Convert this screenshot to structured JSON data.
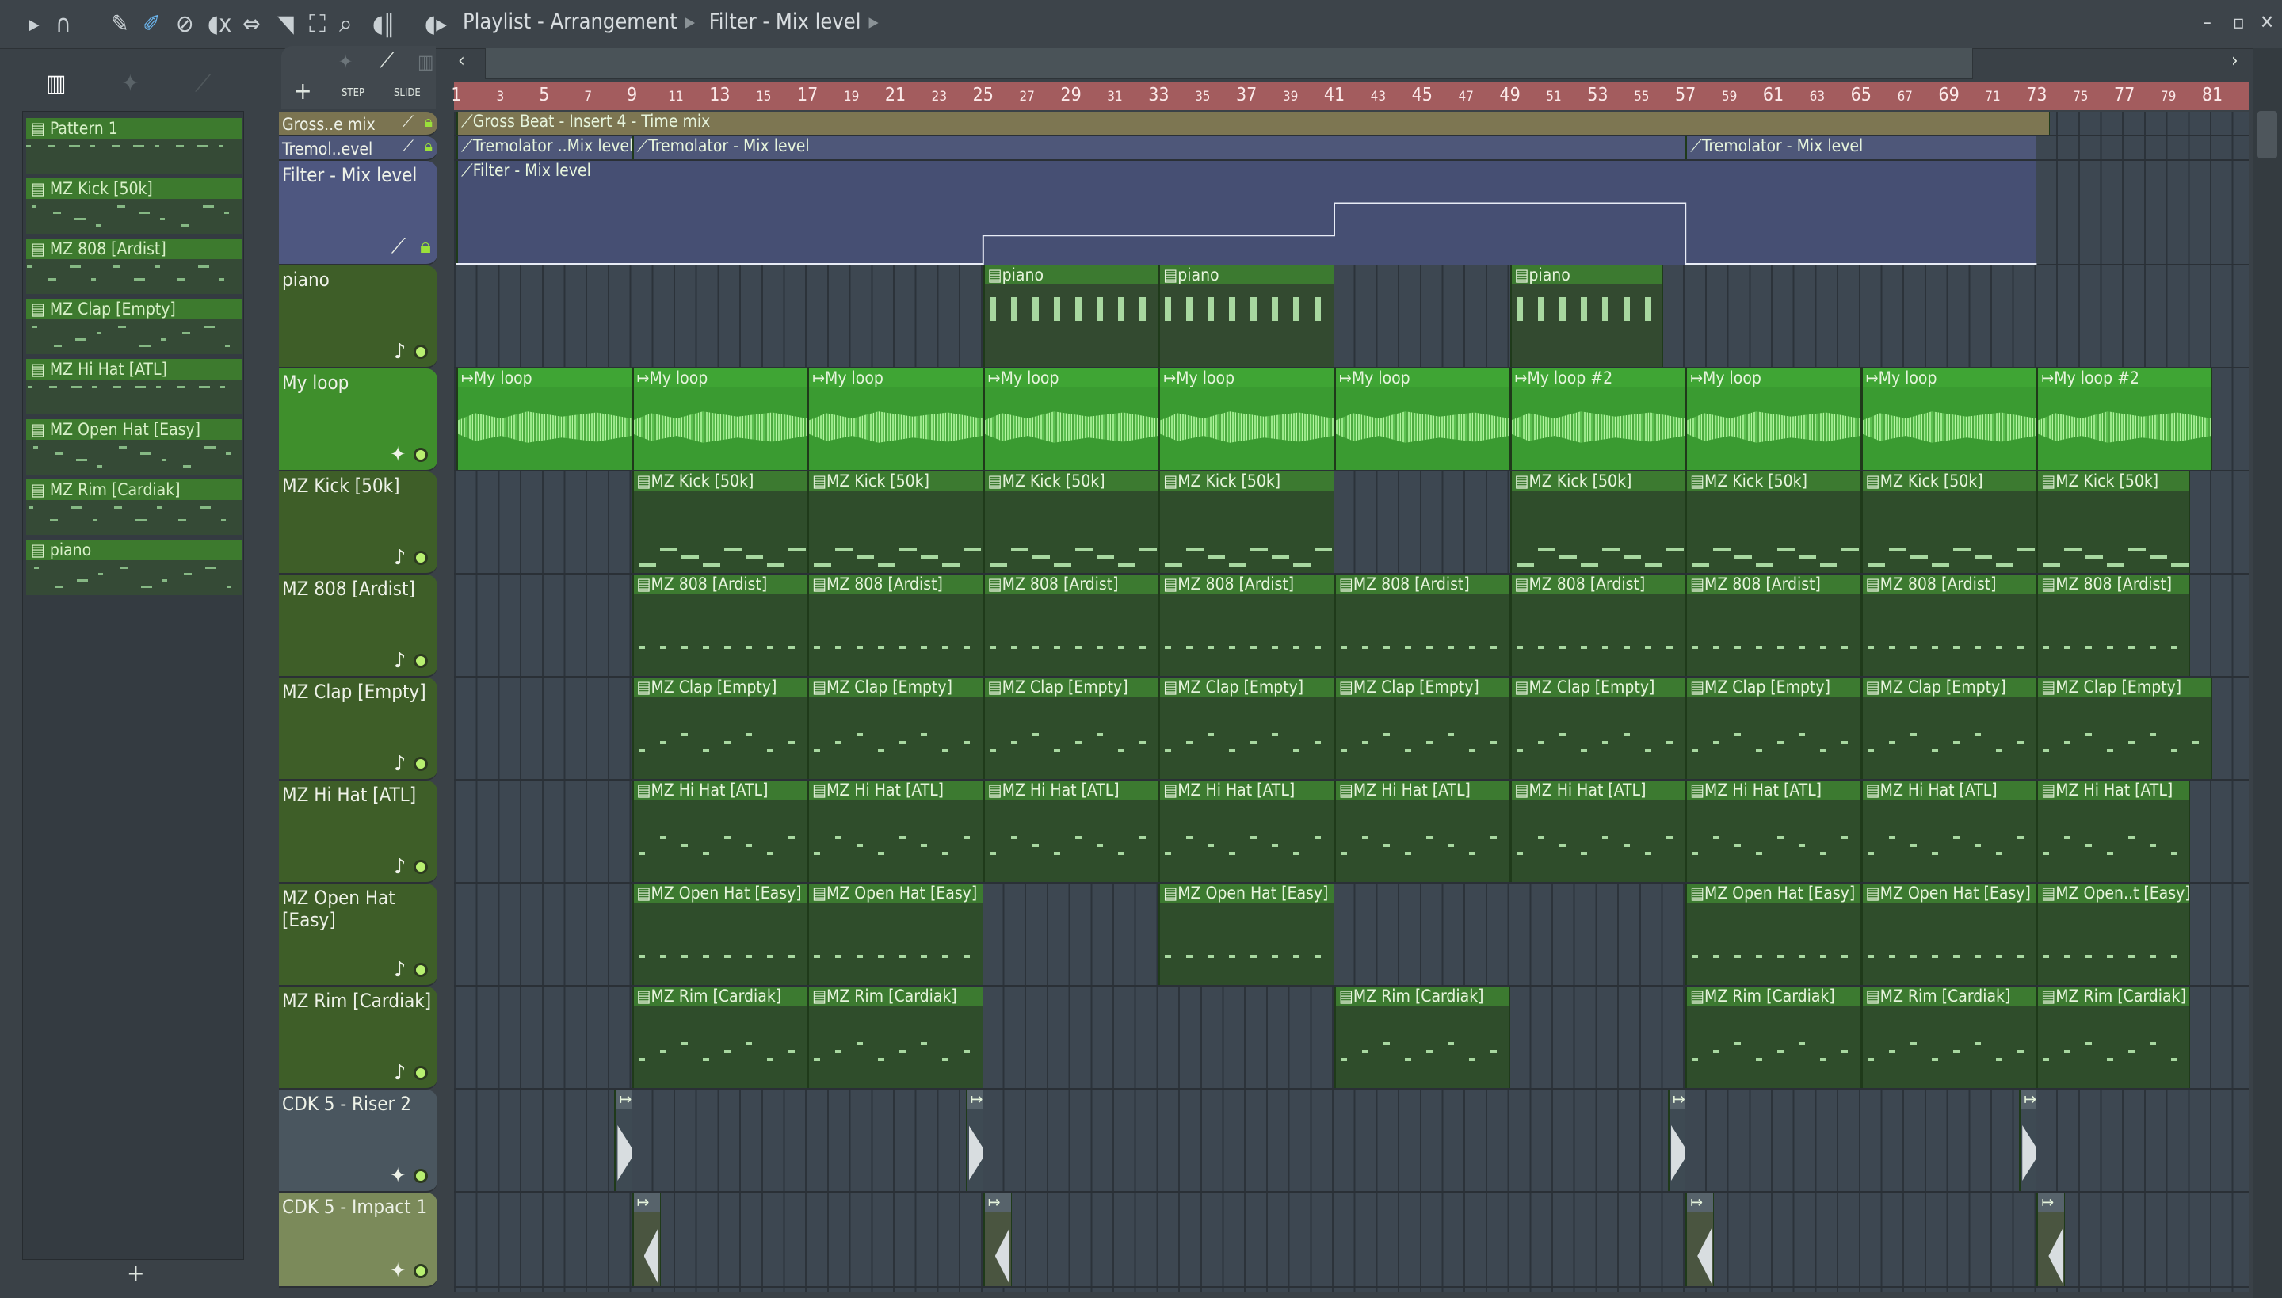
{
  "title": {
    "path": [
      "Playlist - Arrangement",
      "Filter - Mix level"
    ]
  },
  "toolbar": {
    "icons": [
      "play-icon",
      "magnet-icon",
      "pencil-icon",
      "paint-icon",
      "delete-icon",
      "mute-icon",
      "slip-icon",
      "slice-icon",
      "select-icon",
      "zoom-icon",
      "playback-icon",
      "speaker-icon"
    ]
  },
  "side": {
    "step": "STEP",
    "slide": "SLIDE",
    "add": "+"
  },
  "patterns": [
    "Pattern 1",
    "MZ Kick [50k]",
    "MZ 808 [Ardist]",
    "MZ Clap [Empty]",
    "MZ Hi Hat [ATL]",
    "MZ Open Hat [Easy]",
    "MZ Rim [Cardiak]",
    "piano"
  ],
  "ruler": [
    1,
    3,
    5,
    7,
    9,
    11,
    13,
    15,
    17,
    19,
    21,
    23,
    25,
    27,
    29,
    31,
    33,
    35,
    37,
    39,
    41,
    43,
    45,
    47,
    49,
    51,
    53,
    55,
    57,
    59,
    61,
    63,
    65,
    67,
    69,
    71,
    73,
    75,
    77,
    79,
    81
  ],
  "tracks": [
    {
      "name": "Gross..e mix",
      "kind": "auto",
      "color": "#7b7451",
      "clipcolor": "#7d7652",
      "clips": [
        {
          "s": 1,
          "l": 72.6,
          "t": "Gross Beat - Insert 4 - Time mix"
        }
      ]
    },
    {
      "name": "Tremol..evel",
      "kind": "auto",
      "color": "#4e5779",
      "clipcolor": "#4e5779",
      "clips": [
        {
          "s": 1,
          "l": 8,
          "t": "Tremolator ..Mix level"
        },
        {
          "s": 9,
          "l": 48,
          "t": "Tremolator - Mix level"
        },
        {
          "s": 57,
          "l": 16,
          "t": "Tremolator - Mix level"
        }
      ]
    },
    {
      "name": "Filter - Mix level",
      "kind": "autobig",
      "color": "#4e5780",
      "clipcolor": "#464f73",
      "clips": [
        {
          "s": 1,
          "l": 72,
          "t": "Filter - Mix level"
        }
      ]
    },
    {
      "name": "piano",
      "kind": "pat",
      "color": "#3e5e28",
      "clipcolor": "#334a30",
      "clips": [
        {
          "s": 25,
          "l": 8,
          "t": "piano"
        },
        {
          "s": 33,
          "l": 8,
          "t": "piano"
        },
        {
          "s": 49,
          "l": 7,
          "t": "piano"
        }
      ]
    },
    {
      "name": "My loop",
      "kind": "audio",
      "color": "#3f8f2c",
      "clipcolor": "#3a9b31",
      "clips": [
        {
          "s": 1,
          "l": 8,
          "t": "My loop"
        },
        {
          "s": 9,
          "l": 8,
          "t": "My loop"
        },
        {
          "s": 17,
          "l": 8,
          "t": "My loop"
        },
        {
          "s": 25,
          "l": 8,
          "t": "My loop"
        },
        {
          "s": 33,
          "l": 8,
          "t": "My loop"
        },
        {
          "s": 41,
          "l": 8,
          "t": "My loop"
        },
        {
          "s": 49,
          "l": 8,
          "t": "My loop #2"
        },
        {
          "s": 57,
          "l": 8,
          "t": "My loop"
        },
        {
          "s": 65,
          "l": 8,
          "t": "My loop"
        },
        {
          "s": 73,
          "l": 8,
          "t": "My loop #2"
        }
      ]
    },
    {
      "name": "MZ Kick [50k]",
      "kind": "pat",
      "color": "#3e5e28",
      "clipcolor": "#2f4d2b",
      "clips": [
        {
          "s": 9,
          "l": 8,
          "t": "MZ Kick [50k]"
        },
        {
          "s": 17,
          "l": 8,
          "t": "MZ Kick [50k]"
        },
        {
          "s": 25,
          "l": 8,
          "t": "MZ Kick [50k]"
        },
        {
          "s": 33,
          "l": 8,
          "t": "MZ Kick [50k]"
        },
        {
          "s": 49,
          "l": 8,
          "t": "MZ Kick [50k]"
        },
        {
          "s": 57,
          "l": 8,
          "t": "MZ Kick [50k]"
        },
        {
          "s": 65,
          "l": 8,
          "t": "MZ Kick [50k]"
        },
        {
          "s": 73,
          "l": 7,
          "t": "MZ Kick [50k]"
        }
      ]
    },
    {
      "name": "MZ 808 [Ardist]",
      "kind": "pat",
      "color": "#3e5e28",
      "clipcolor": "#2f4d2b",
      "clips": [
        {
          "s": 9,
          "l": 8,
          "t": "MZ 808 [Ardist]"
        },
        {
          "s": 17,
          "l": 8,
          "t": "MZ 808 [Ardist]"
        },
        {
          "s": 25,
          "l": 8,
          "t": "MZ 808 [Ardist]"
        },
        {
          "s": 33,
          "l": 8,
          "t": "MZ 808 [Ardist]"
        },
        {
          "s": 41,
          "l": 8,
          "t": "MZ 808 [Ardist]"
        },
        {
          "s": 49,
          "l": 8,
          "t": "MZ 808 [Ardist]"
        },
        {
          "s": 57,
          "l": 8,
          "t": "MZ 808 [Ardist]"
        },
        {
          "s": 65,
          "l": 8,
          "t": "MZ 808 [Ardist]"
        },
        {
          "s": 73,
          "l": 7,
          "t": "MZ 808 [Ardist]"
        }
      ]
    },
    {
      "name": "MZ Clap [Empty]",
      "kind": "pat",
      "color": "#3e5e28",
      "clipcolor": "#2f4d2b",
      "clips": [
        {
          "s": 9,
          "l": 8,
          "t": "MZ Clap [Empty]"
        },
        {
          "s": 17,
          "l": 8,
          "t": "MZ Clap [Empty]"
        },
        {
          "s": 25,
          "l": 8,
          "t": "MZ Clap [Empty]"
        },
        {
          "s": 33,
          "l": 8,
          "t": "MZ Clap [Empty]"
        },
        {
          "s": 41,
          "l": 8,
          "t": "MZ Clap [Empty]"
        },
        {
          "s": 49,
          "l": 8,
          "t": "MZ Clap [Empty]"
        },
        {
          "s": 57,
          "l": 8,
          "t": "MZ Clap [Empty]"
        },
        {
          "s": 65,
          "l": 8,
          "t": "MZ Clap [Empty]"
        },
        {
          "s": 73,
          "l": 8,
          "t": "MZ Clap [Empty]"
        }
      ]
    },
    {
      "name": "MZ Hi Hat [ATL]",
      "kind": "pat",
      "color": "#3e5e28",
      "clipcolor": "#2f4d2b",
      "clips": [
        {
          "s": 9,
          "l": 8,
          "t": "MZ Hi Hat [ATL]"
        },
        {
          "s": 17,
          "l": 8,
          "t": "MZ Hi Hat [ATL]"
        },
        {
          "s": 25,
          "l": 8,
          "t": "MZ Hi Hat [ATL]"
        },
        {
          "s": 33,
          "l": 8,
          "t": "MZ Hi Hat [ATL]"
        },
        {
          "s": 41,
          "l": 8,
          "t": "MZ Hi Hat [ATL]"
        },
        {
          "s": 49,
          "l": 8,
          "t": "MZ Hi Hat [ATL]"
        },
        {
          "s": 57,
          "l": 8,
          "t": "MZ Hi Hat [ATL]"
        },
        {
          "s": 65,
          "l": 8,
          "t": "MZ Hi Hat [ATL]"
        },
        {
          "s": 73,
          "l": 7,
          "t": "MZ Hi Hat [ATL]"
        }
      ]
    },
    {
      "name": "MZ Open Hat [Easy]",
      "kind": "pat",
      "color": "#3e5e28",
      "clipcolor": "#2f4d2b",
      "clips": [
        {
          "s": 9,
          "l": 8,
          "t": "MZ Open Hat [Easy]"
        },
        {
          "s": 17,
          "l": 8,
          "t": "MZ Open Hat [Easy]"
        },
        {
          "s": 33,
          "l": 8,
          "t": "MZ Open Hat [Easy]"
        },
        {
          "s": 57,
          "l": 8,
          "t": "MZ Open Hat [Easy]"
        },
        {
          "s": 65,
          "l": 8,
          "t": "MZ Open Hat [Easy]"
        },
        {
          "s": 73,
          "l": 7,
          "t": "MZ Open..t [Easy]"
        }
      ]
    },
    {
      "name": "MZ Rim [Cardiak]",
      "kind": "pat",
      "color": "#3e5e28",
      "clipcolor": "#2f4d2b",
      "clips": [
        {
          "s": 9,
          "l": 8,
          "t": "MZ Rim [Cardiak]"
        },
        {
          "s": 17,
          "l": 8,
          "t": "MZ Rim [Cardiak]"
        },
        {
          "s": 41,
          "l": 8,
          "t": "MZ Rim [Cardiak]"
        },
        {
          "s": 57,
          "l": 8,
          "t": "MZ Rim [Cardiak]"
        },
        {
          "s": 65,
          "l": 8,
          "t": "MZ Rim [Cardiak]"
        },
        {
          "s": 73,
          "l": 7,
          "t": "MZ Rim [Cardiak]"
        }
      ]
    },
    {
      "name": "CDK 5 - Riser 2",
      "kind": "audio2",
      "color": "#4a565f",
      "clipcolor": "#3e4a53",
      "clips": [
        {
          "s": 8.2,
          "l": 0.8,
          "t": ""
        },
        {
          "s": 24.2,
          "l": 0.8,
          "t": ""
        },
        {
          "s": 56.2,
          "l": 0.8,
          "t": ""
        },
        {
          "s": 72.2,
          "l": 0.8,
          "t": ""
        }
      ]
    },
    {
      "name": "CDK 5 - Impact 1",
      "kind": "audio2",
      "color": "#7b8a5a",
      "clipcolor": "#4a5540",
      "clips": [
        {
          "s": 9,
          "l": 1.3,
          "t": ""
        },
        {
          "s": 25,
          "l": 1.3,
          "t": ""
        },
        {
          "s": 57,
          "l": 1.3,
          "t": ""
        },
        {
          "s": 73,
          "l": 1.3,
          "t": ""
        }
      ]
    }
  ],
  "filter_automation": {
    "points": [
      [
        1,
        0
      ],
      [
        25,
        0
      ],
      [
        25,
        0.35
      ],
      [
        41,
        0.35
      ],
      [
        41,
        0.75
      ],
      [
        57,
        0.75
      ],
      [
        57,
        0
      ],
      [
        73,
        0
      ]
    ]
  }
}
